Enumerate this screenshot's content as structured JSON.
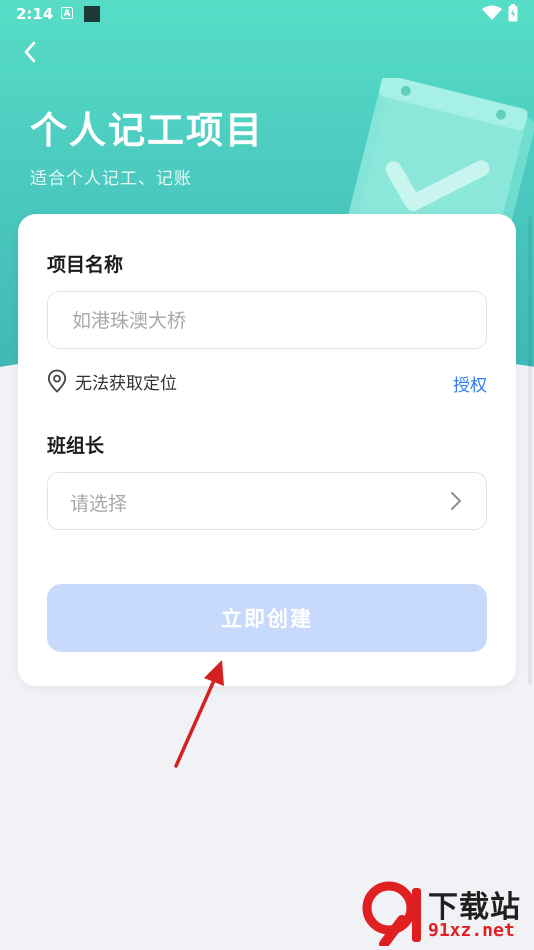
{
  "status_bar": {
    "time": "2:14",
    "notification_letter": "A"
  },
  "header": {
    "title": "个人记工项目",
    "subtitle": "适合个人记工、记账"
  },
  "form": {
    "project_name": {
      "label": "项目名称",
      "placeholder": "如港珠澳大桥",
      "value": ""
    },
    "location": {
      "status_text": "无法获取定位",
      "authorize_label": "授权"
    },
    "team_leader": {
      "label": "班组长",
      "placeholder": "请选择"
    },
    "submit_label": "立即创建"
  },
  "watermark": {
    "logo_text": "9",
    "title": "下载站",
    "url": "91xz.net"
  },
  "colors": {
    "header_gradient_top": "#57ddc6",
    "header_gradient_bottom": "#3fb8b6",
    "link_blue": "#2f7cf6",
    "button_disabled": "#c7dafc",
    "page_bg": "#f1f2f6",
    "arrow_red": "#d42020"
  }
}
